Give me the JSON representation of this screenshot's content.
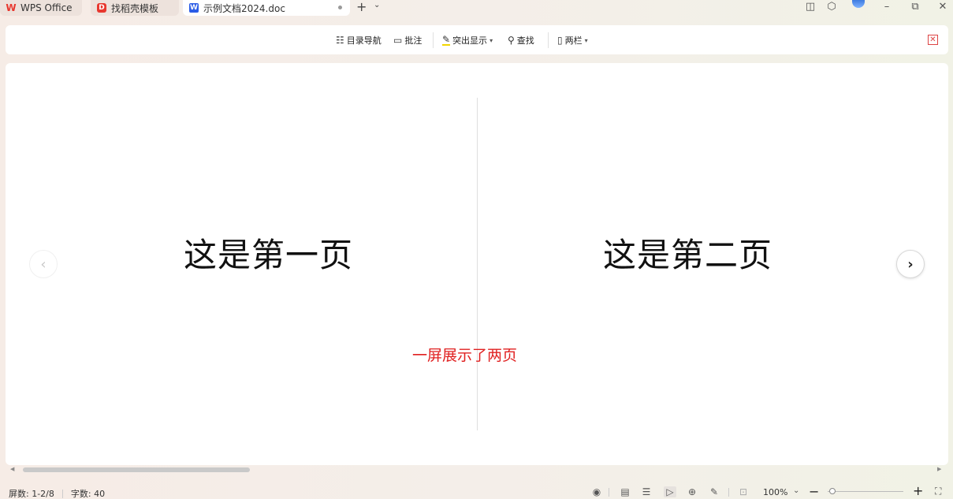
{
  "tabs": [
    {
      "label": "WPS Office",
      "icon": "wps-logo-icon"
    },
    {
      "label": "找稻壳模板",
      "icon": "docer-icon"
    },
    {
      "label": "示例文档2024.doc",
      "icon": "word-doc-icon"
    }
  ],
  "toolbar": {
    "toc_label": "目录导航",
    "comment_label": "批注",
    "highlight_label": "突出显示",
    "find_label": "查找",
    "columns_label": "两栏"
  },
  "document": {
    "page1_text": "这是第一页",
    "page2_text": "这是第二页",
    "annotation": "一屏展示了两页"
  },
  "status": {
    "pages": "屏数: 1-2/8",
    "words": "字数: 40",
    "zoom": "100%"
  },
  "colors": {
    "wps_red": "#e8382f",
    "doc_blue": "#2b5ce6",
    "annotation_red": "#e02020"
  }
}
